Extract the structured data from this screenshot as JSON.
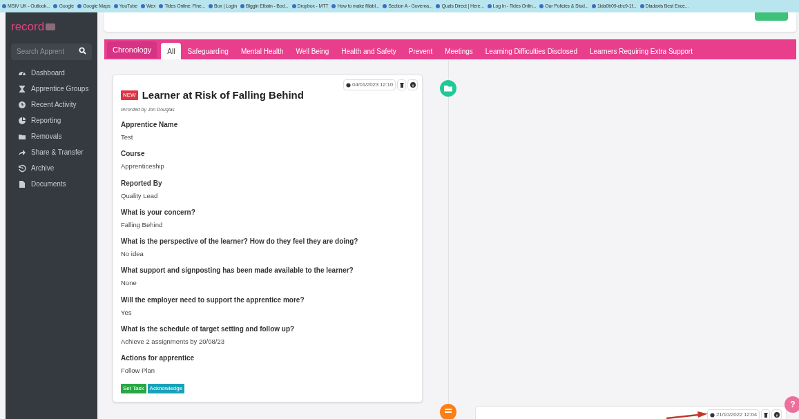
{
  "bookmarks": [
    "MSIV UK - Outlook...",
    "Google",
    "Google Maps",
    "YouTube",
    "Wex",
    "Tides Online: Fine...",
    "Box | Login",
    "Biggin Elbain - Bod...",
    "Dropbox - MTT",
    "How to make fillabl...",
    "Section A - Governa...",
    "Quals Direct | Here...",
    "Log In - Tides Onlin...",
    "Our Policies & Stud...",
    "1ida0b09-cbc9-1f...",
    "Diadaxis Best Exce..."
  ],
  "sidebar": {
    "logo": "record",
    "search": {
      "placeholder": "Search Apprent"
    },
    "items": [
      {
        "label": "Dashboard"
      },
      {
        "label": "Apprentice Groups"
      },
      {
        "label": "Recent Activity"
      },
      {
        "label": "Reporting"
      },
      {
        "label": "Removals"
      },
      {
        "label": "Share & Transfer"
      },
      {
        "label": "Archive"
      },
      {
        "label": "Documents"
      }
    ]
  },
  "tabs": [
    {
      "label": "Chronology",
      "kind": "heading",
      "selected": false
    },
    {
      "label": "All",
      "kind": "tab",
      "selected": true
    },
    {
      "label": "Safeguarding",
      "kind": "tab",
      "selected": false
    },
    {
      "label": "Mental Health",
      "kind": "tab",
      "selected": false
    },
    {
      "label": "Well Being",
      "kind": "tab",
      "selected": false
    },
    {
      "label": "Health and Safety",
      "kind": "tab",
      "selected": false
    },
    {
      "label": "Prevent",
      "kind": "tab",
      "selected": false
    },
    {
      "label": "Meetings",
      "kind": "tab",
      "selected": false
    },
    {
      "label": "Learning Difficulties Disclosed",
      "kind": "tab",
      "selected": false
    },
    {
      "label": "Learners Requiring Extra Support",
      "kind": "tab",
      "selected": false
    }
  ],
  "entries": [
    {
      "badge": "NEW",
      "title": "Learner at Risk of Falling Behind",
      "recorded_by": "recorded by Jon Douglas",
      "timestamp": "04/01/2023 12:10",
      "fields": [
        {
          "label": "Apprentice Name",
          "value": "Test"
        },
        {
          "label": "Course",
          "value": "Apprenticeship"
        },
        {
          "label": "Reported By",
          "value": "Quality Lead"
        },
        {
          "label": "What is your concern?",
          "value": "Falling Behind"
        },
        {
          "label": "What is the perspective of the learner? How do they feel they are doing?",
          "value": "No idea"
        },
        {
          "label": "What support and signposting has been made available to the learner?",
          "value": "None"
        },
        {
          "label": "Will the employer need to support the apprentice more?",
          "value": "Yes"
        },
        {
          "label": "What is the schedule of target setting and follow up?",
          "value": "Achieve 2 assignments by 20/08/23"
        },
        {
          "label": "Actions for apprentice",
          "value": "Follow Plan"
        }
      ],
      "actions": [
        "Set Task",
        "Acknowledge"
      ]
    },
    {
      "timestamp": "21/10/2022 12:04"
    }
  ],
  "help_button": "?"
}
